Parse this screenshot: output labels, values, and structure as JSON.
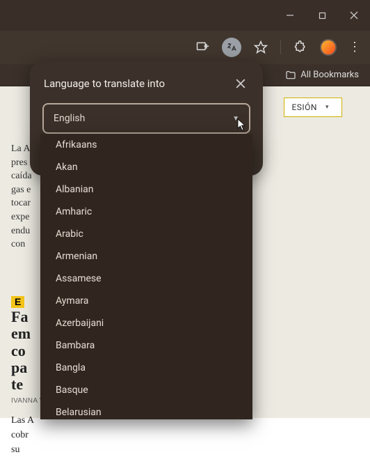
{
  "bookmark_bar": {
    "all_bookmarks": "All Bookmarks"
  },
  "page": {
    "login_button": "ESIÓN",
    "article1": "La A\npres\ncaída\ngas e\ntocar\nexpe\nendu\ncon",
    "badge": "E",
    "headline2_letters": "Fa\nem\nco\npa\nte",
    "byline": "IVANNA V",
    "article2": "Las A\ncobr\nsu"
  },
  "popup": {
    "title": "Language to translate into",
    "selected": "English"
  },
  "languages": [
    "Afrikaans",
    "Akan",
    "Albanian",
    "Amharic",
    "Arabic",
    "Armenian",
    "Assamese",
    "Aymara",
    "Azerbaijani",
    "Bambara",
    "Bangla",
    "Basque",
    "Belarusian"
  ]
}
